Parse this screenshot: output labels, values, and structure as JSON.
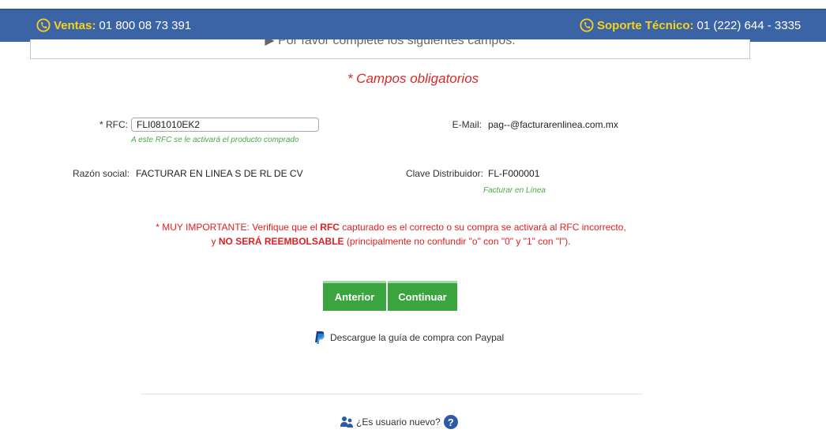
{
  "header": {
    "sales_label": "Ventas:",
    "sales_phone": "01 800 08 73 391",
    "support_label": "Soporte Técnico:",
    "support_phone": "01 (222) 644 - 3335"
  },
  "panel": {
    "text": "▶ Por favor complete los siguientes campos."
  },
  "form": {
    "required_note": "* Campos obligatorios",
    "rfc_label": "* RFC:",
    "rfc_value": "FLI081010EK2",
    "rfc_note": "A este RFC se le activará el producto comprado",
    "email_label": "E-Mail:",
    "email_value": "pag--@facturarenlinea.com.mx",
    "razon_label": "Razón social:",
    "razon_value": "FACTURAR EN LINEA S DE RL DE CV",
    "clave_label": "Clave Distribuidor:",
    "clave_value": "FL-F000001",
    "clave_note": "Facturar en Línea"
  },
  "warning": {
    "p1": "* MUY IMPORTANTE: Verifique que el ",
    "rfc": "RFC",
    "p2": " capturado es el correcto o su compra se activará al RFC incorrecto,",
    "p3": "y ",
    "no_reembolsable": "NO SERÁ REEMBOLSABLE",
    "p4": " (principalmente no confundir \"o\" con \"0\" y \"1\" con \"l\")."
  },
  "buttons": {
    "previous": "Anterior",
    "next": "Continuar"
  },
  "paypal_link": "Descargue la guía de compra con Paypal",
  "new_user": "¿Es usuario nuevo?",
  "icons": {
    "phone": "phone-icon",
    "paypal": "paypal-icon",
    "user": "user-group-icon",
    "help": "question-icon"
  }
}
